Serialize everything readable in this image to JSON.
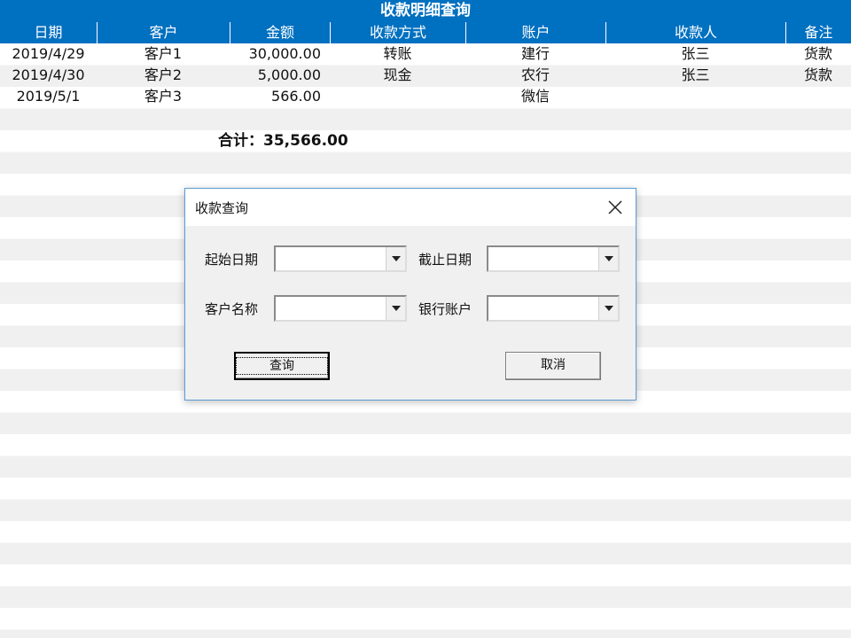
{
  "sheet": {
    "title": "收款明细查询",
    "headers": [
      "日期",
      "客户",
      "金额",
      "收款方式",
      "账户",
      "收款人",
      "备注"
    ],
    "rows": [
      [
        "2019/4/29",
        "客户1",
        "30,000.00",
        "转账",
        "建行",
        "张三",
        "货款"
      ],
      [
        "2019/4/30",
        "客户2",
        "5,000.00",
        "现金",
        "农行",
        "张三",
        "货款"
      ],
      [
        "2019/5/1",
        "客户3",
        "566.00",
        "",
        "微信",
        "",
        ""
      ]
    ],
    "total_label": "合计：",
    "total_value": "35,566.00"
  },
  "dialog": {
    "title": "收款查询",
    "start_date_label": "起始日期",
    "end_date_label": "截止日期",
    "customer_label": "客户名称",
    "bank_label": "银行账户",
    "start_date_value": "",
    "end_date_value": "",
    "customer_value": "",
    "bank_value": "",
    "query_button": "查询",
    "cancel_button": "取消"
  },
  "colors": {
    "header_bg": "#0070c0",
    "header_text": "#ffffff",
    "stripe": "#f0f0f0",
    "dialog_border": "#5b9bd5"
  },
  "icons": {
    "close": "close-x-icon",
    "dropdown": "chevron-down-icon"
  }
}
